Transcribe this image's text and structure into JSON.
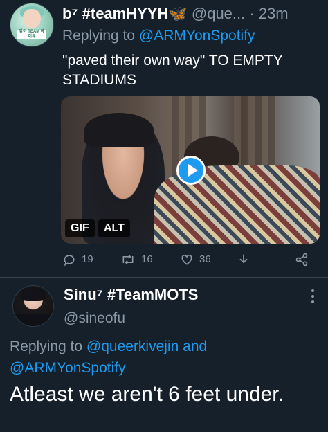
{
  "tweet1": {
    "display_name": "b⁷ #teamHYYH🦋",
    "handle": "@que...",
    "time": "· 23m",
    "replying_prefix": "Replying to",
    "replying_to": "@ARMYonSpotify",
    "text": "\"paved their own way\" TO EMPTY STADIUMS",
    "avatar_badge": "앞이\nTEAM\n헤이유",
    "media": {
      "gif_label": "GIF",
      "alt_label": "ALT"
    },
    "actions": {
      "replies": "19",
      "retweets": "16",
      "likes": "36"
    }
  },
  "tweet2": {
    "display_name": "Sinu⁷ #TeamMOTS",
    "handle": "@sineofu",
    "replying_prefix": "Replying to",
    "replying_to_1": "@queerkivejin",
    "replying_joiner": "and",
    "replying_to_2": "@ARMYonSpotify",
    "text": "Atleast we aren't 6 feet under."
  },
  "colors": {
    "background": "#15202b",
    "accent": "#1d9bf0",
    "muted": "#8b98a5",
    "divider": "#38444d"
  }
}
